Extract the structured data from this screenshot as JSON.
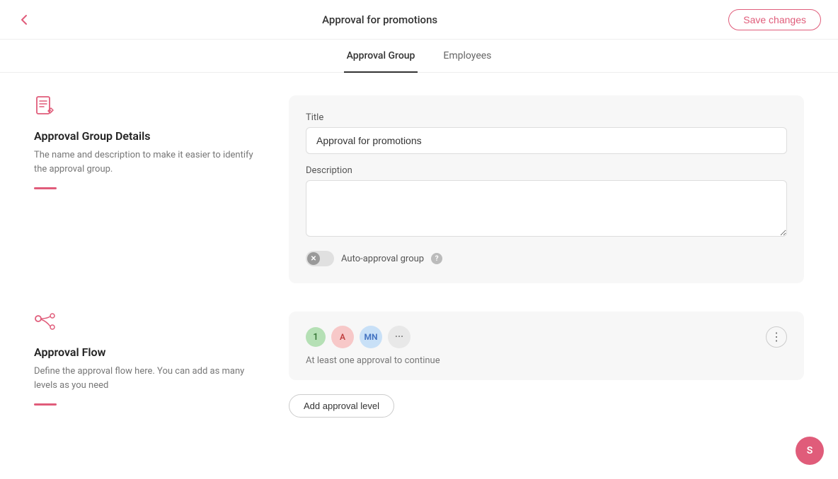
{
  "header": {
    "title": "Approval for promotions",
    "save_label": "Save changes",
    "back_aria": "Go back"
  },
  "tabs": [
    {
      "id": "approval-group",
      "label": "Approval Group",
      "active": true
    },
    {
      "id": "employees",
      "label": "Employees",
      "active": false
    }
  ],
  "approval_group_section": {
    "icon_name": "document-edit-icon",
    "title": "Approval Group Details",
    "description": "The name and description to make it easier to identify the approval group.",
    "form": {
      "title_label": "Title",
      "title_value": "Approval for promotions",
      "title_placeholder": "Enter title",
      "description_label": "Description",
      "description_value": "",
      "description_placeholder": "",
      "toggle_label": "Auto-approval group",
      "toggle_checked": false,
      "help_text": "?"
    }
  },
  "approval_flow_section": {
    "icon_name": "flow-icon",
    "title": "Approval Flow",
    "description": "Define the approval flow here. You can add as many levels as you need",
    "flow_level": {
      "number": "1",
      "avatars": [
        {
          "initials": "A",
          "style": "a"
        },
        {
          "initials": "MN",
          "style": "mn"
        },
        {
          "initials": "...",
          "style": "more"
        }
      ],
      "sub_label": "At least one approval to continue"
    },
    "add_level_label": "Add approval level"
  },
  "bottom_avatar": {
    "initials": "S"
  }
}
